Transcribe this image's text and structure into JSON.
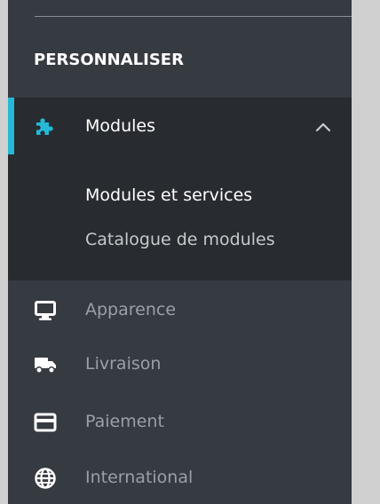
{
  "sidebar": {
    "section_title": "PERSONNALISER",
    "modules": {
      "label": "Modules",
      "icon": "puzzle-icon",
      "expanded": true,
      "submenu": [
        {
          "label": "Modules et services",
          "active": true
        },
        {
          "label": "Catalogue de modules",
          "active": false
        }
      ]
    },
    "items": [
      {
        "label": "Apparence",
        "icon": "monitor-icon"
      },
      {
        "label": "Livraison",
        "icon": "truck-icon"
      },
      {
        "label": "Paiement",
        "icon": "credit-card-icon"
      },
      {
        "label": "International",
        "icon": "globe-icon"
      }
    ]
  },
  "colors": {
    "sidebar_bg": "#363a41",
    "active_group_bg": "#282b30",
    "accent": "#25b9d7",
    "page_bg": "#d0d0d0"
  }
}
